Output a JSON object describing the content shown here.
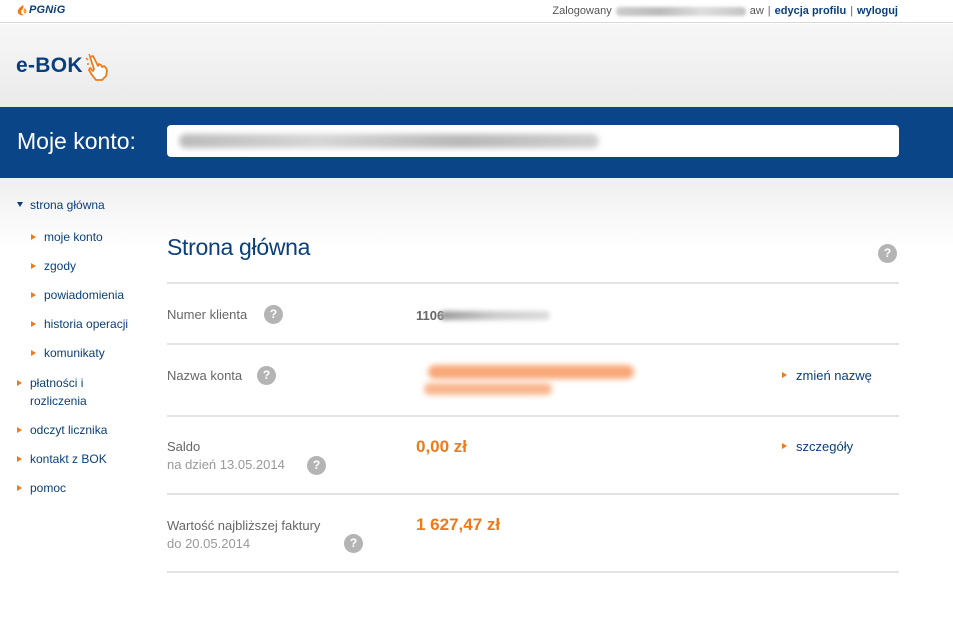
{
  "topbar": {
    "brand": "PGNiG",
    "logged_in_label": "Zalogowany",
    "logged_in_suffix": "aw",
    "edit_profile": "edycja profilu",
    "logout": "wyloguj",
    "separator": "|"
  },
  "header": {
    "logo_text": "e-BOK"
  },
  "accountbar": {
    "label": "Moje konto:"
  },
  "sidebar": {
    "items": [
      {
        "label": "strona główna",
        "level": 0,
        "expanded": true
      },
      {
        "label": "moje konto",
        "level": 1
      },
      {
        "label": "zgody",
        "level": 1
      },
      {
        "label": "powiadomienia",
        "level": 1
      },
      {
        "label": "historia operacji",
        "level": 1
      },
      {
        "label": "komunikaty",
        "level": 1
      },
      {
        "label": "płatności i",
        "label2": "rozliczenia",
        "level": 0
      },
      {
        "label": "odczyt licznika",
        "level": 0
      },
      {
        "label": "kontakt z BOK",
        "level": 0
      },
      {
        "label": "pomoc",
        "level": 0
      }
    ]
  },
  "main": {
    "title": "Strona główna",
    "help_glyph": "?",
    "rows": {
      "client_number": {
        "label": "Numer klienta",
        "value_prefix": "1106"
      },
      "account_name": {
        "label": "Nazwa konta",
        "action": "zmień nazwę"
      },
      "balance": {
        "label": "Saldo",
        "sub": "na dzień 13.05.2014",
        "value": "0,00 zł",
        "action": "szczegóły"
      },
      "next_invoice": {
        "label": "Wartość najbliższej faktury",
        "sub": "do 20.05.2014",
        "value": "1 627,47 zł"
      }
    }
  },
  "colors": {
    "brand_blue": "#0a4587",
    "accent_orange": "#f07a1a"
  }
}
